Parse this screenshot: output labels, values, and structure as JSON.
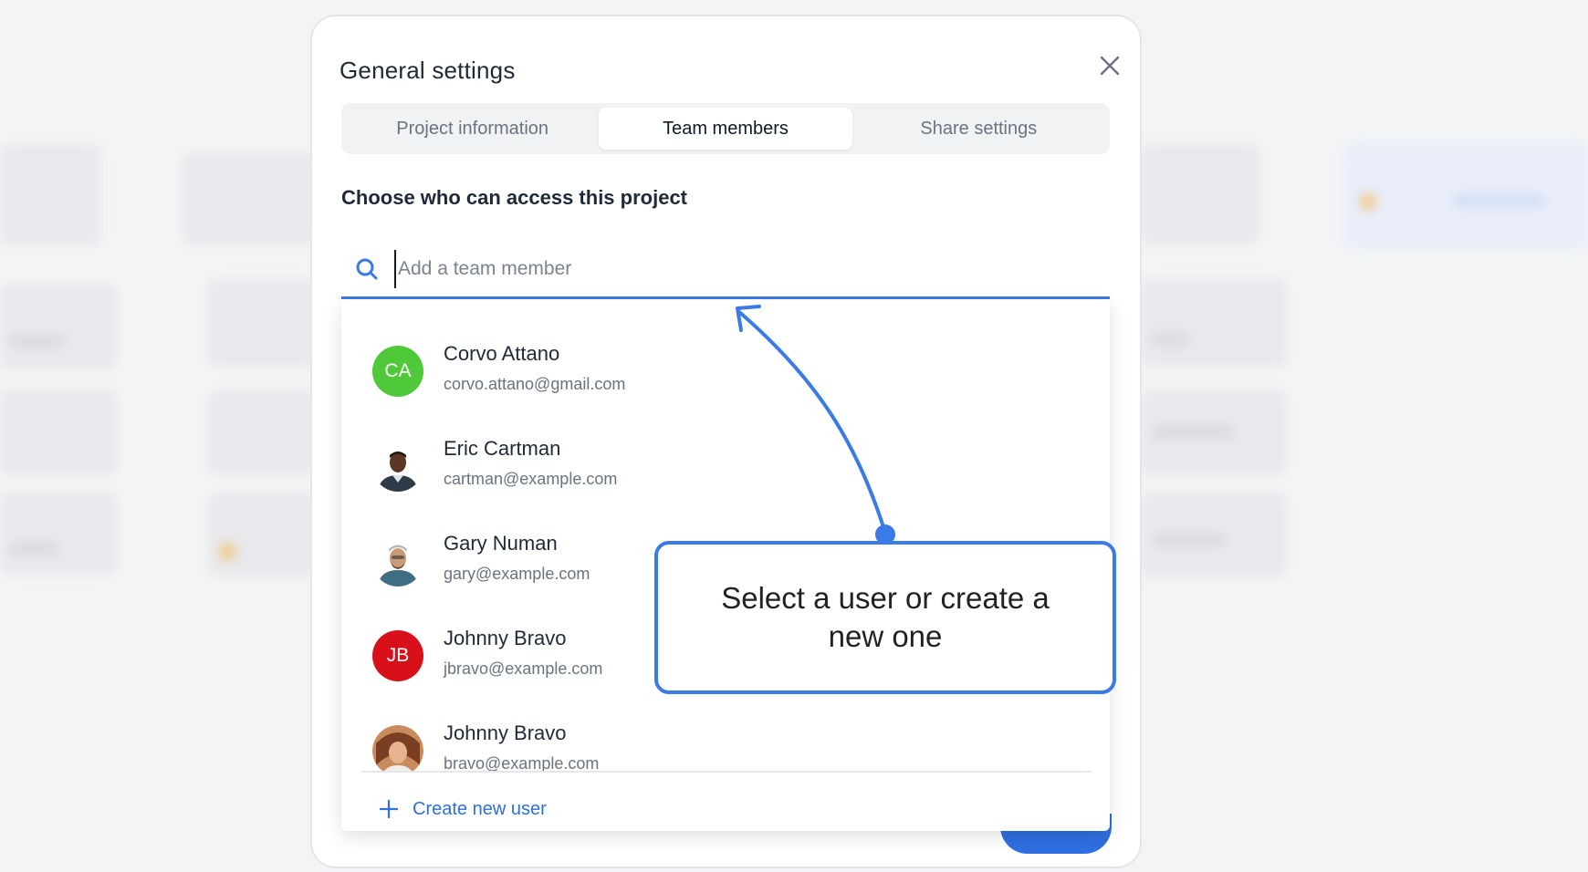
{
  "modal": {
    "title": "General settings",
    "close_icon": "close-icon"
  },
  "tabs": [
    {
      "label": "Project information",
      "active": false
    },
    {
      "label": "Team members",
      "active": true
    },
    {
      "label": "Share settings",
      "active": false
    }
  ],
  "section": {
    "title": "Choose who can access this project"
  },
  "search": {
    "icon": "search-icon",
    "placeholder": "Add a team member",
    "value": ""
  },
  "users": [
    {
      "name": "Corvo Attano",
      "email": "corvo.attano@gmail.com",
      "initials": "CA",
      "avatar_color": "#4fc83a"
    },
    {
      "name": "Eric Cartman",
      "email": "cartman@example.com",
      "initials": "",
      "avatar_color": "#ffffff"
    },
    {
      "name": "Gary Numan",
      "email": "gary@example.com",
      "initials": "",
      "avatar_color": "#ffffff"
    },
    {
      "name": "Johnny Bravo",
      "email": "jbravo@example.com",
      "initials": "JB",
      "avatar_color": "#d7101a"
    },
    {
      "name": "Johnny Bravo",
      "email": "bravo@example.com",
      "initials": "",
      "avatar_color": "#c98a5e"
    }
  ],
  "create_new": {
    "label": "Create new user",
    "icon": "plus-icon"
  },
  "callout": {
    "text": "Select a user or create a new one"
  },
  "colors": {
    "accent": "#3b7be8",
    "link": "#2f6fd9"
  }
}
